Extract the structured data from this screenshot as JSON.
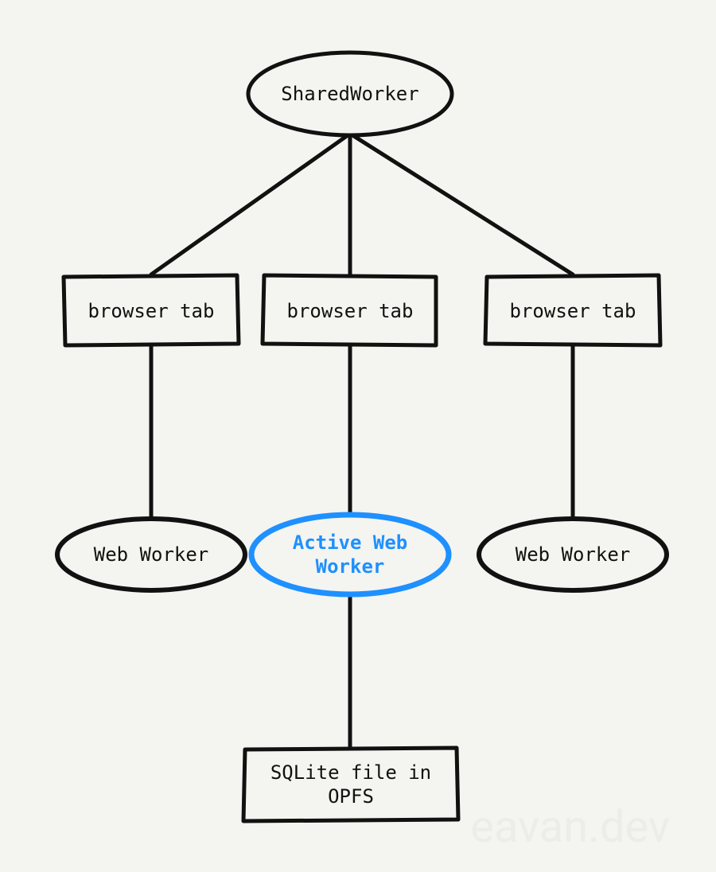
{
  "sharedWorker": {
    "label": "SharedWorker"
  },
  "tabs": [
    {
      "label": "browser tab"
    },
    {
      "label": "browser tab"
    },
    {
      "label": "browser tab"
    }
  ],
  "workers": [
    {
      "label": "Web Worker",
      "active": false
    },
    {
      "label": "Active Web Worker",
      "active": true
    },
    {
      "label": "Web Worker",
      "active": false
    }
  ],
  "storage": {
    "label": "SQLite file in OPFS"
  },
  "watermark": "eavan.dev",
  "colors": {
    "stroke": "#111111",
    "active": "#1E90FF"
  }
}
